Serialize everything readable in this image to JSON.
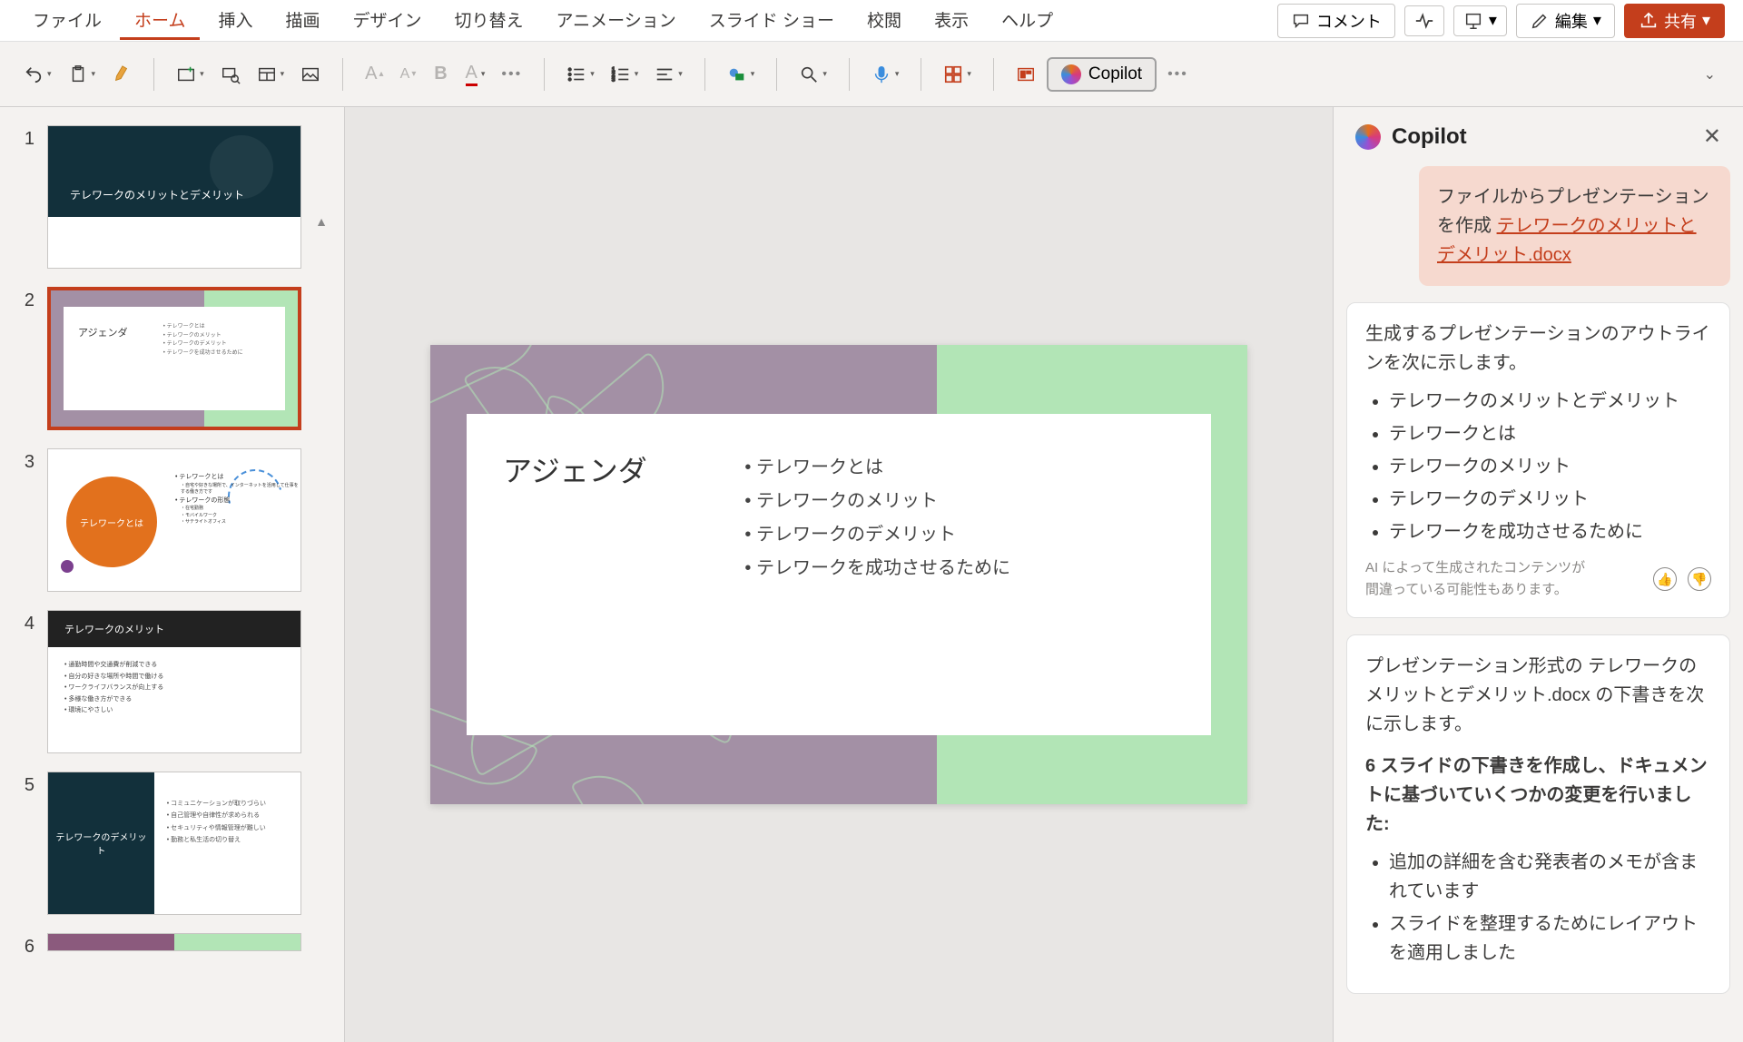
{
  "menu": {
    "items": [
      "ファイル",
      "ホーム",
      "挿入",
      "描画",
      "デザイン",
      "切り替え",
      "アニメーション",
      "スライド ショー",
      "校閲",
      "表示",
      "ヘルプ"
    ],
    "active_index": 1,
    "comment": "コメント",
    "edit": "編集",
    "share": "共有"
  },
  "ribbon": {
    "copilot_label": "Copilot"
  },
  "thumbnails": {
    "selected_index": 2,
    "slides": [
      {
        "num": "1",
        "title": "テレワークのメリットとデメリット"
      },
      {
        "num": "2",
        "title": "アジェンダ",
        "items": [
          "テレワークとは",
          "テレワークのメリット",
          "テレワークのデメリット",
          "テレワークを成功させるために"
        ]
      },
      {
        "num": "3",
        "title": "テレワークとは",
        "items": [
          "テレワークとは",
          "・自宅や好きな場所で、インターネットを活用して仕事をする働き方です",
          "テレワークの形態",
          "・在宅勤務",
          "・モバイルワーク",
          "・サテライトオフィス"
        ]
      },
      {
        "num": "4",
        "title": "テレワークのメリット",
        "items": [
          "通勤時間や交通費が削減できる",
          "自分の好きな場所や時間で働ける",
          "ワークライフバランスが向上する",
          "多様な働き方ができる",
          "環境にやさしい"
        ]
      },
      {
        "num": "5",
        "title": "テレワークのデメリット",
        "items": [
          "コミュニケーションが取りづらい",
          "自己管理や自律性が求められる",
          "セキュリティや情報管理が難しい",
          "勤務と私生活の切り替え"
        ]
      },
      {
        "num": "6",
        "title": ""
      }
    ]
  },
  "current_slide": {
    "title": "アジェンダ",
    "items": [
      "テレワークとは",
      "テレワークのメリット",
      "テレワークのデメリット",
      "テレワークを成功させるために"
    ]
  },
  "copilot": {
    "title": "Copilot",
    "user_msg_prefix": "ファイルからプレゼンテーションを作成 ",
    "user_msg_link": "テレワークのメリットとデメリット.docx",
    "bot1_intro": "生成するプレゼンテーションのアウトラインを次に示します。",
    "bot1_items": [
      "テレワークのメリットとデメリット",
      "テレワークとは",
      "テレワークのメリット",
      "テレワークのデメリット",
      "テレワークを成功させるために"
    ],
    "ai_note": "AI によって生成されたコンテンツが間違っている可能性もあります。",
    "bot2_intro": "プレゼンテーション形式の テレワークのメリットとデメリット.docx の下書きを次に示します。",
    "bot2_headline": "6 スライドの下書きを作成し、ドキュメントに基づいていくつかの変更を行いました:",
    "bot2_items": [
      "追加の詳細を含む発表者のメモが含まれています",
      "スライドを整理するためにレイアウトを適用しました"
    ]
  }
}
